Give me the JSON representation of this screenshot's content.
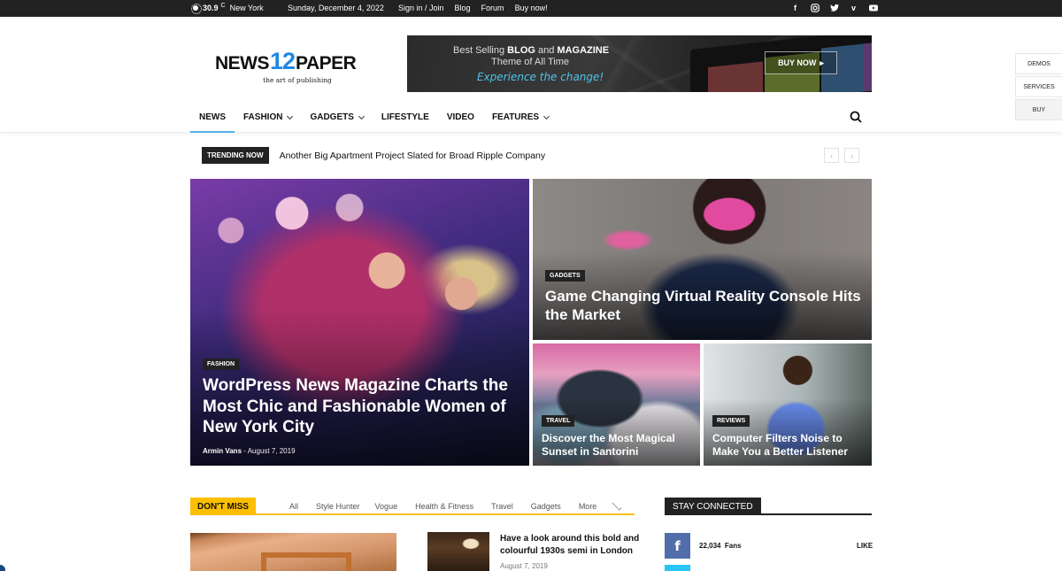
{
  "topbar": {
    "weather_icon": "sun-icon",
    "temperature": "30.9",
    "unit": "C",
    "city": "New York",
    "date": "Sunday, December 4, 2022",
    "links": [
      "Sign in / Join",
      "Blog",
      "Forum",
      "Buy now!"
    ],
    "social": [
      "facebook-icon",
      "instagram-icon",
      "twitter-icon",
      "vimeo-icon",
      "youtube-icon"
    ]
  },
  "header": {
    "logo": {
      "left": "NEWS",
      "number": "12",
      "right": "PAPER",
      "tagline": "the art of publishing"
    },
    "banner": {
      "line1_prefix": "Best Selling ",
      "line1_bold1": "BLOG",
      "line1_mid": " and ",
      "line1_bold2": "MAGAZINE",
      "line2": "Theme of All Time",
      "line3": "Experience the change!",
      "button": "BUY NOW",
      "button_icon": "caret-right-icon"
    },
    "side_tabs": [
      "DEMOS",
      "SERVICES",
      "BUY"
    ]
  },
  "nav": {
    "items": [
      {
        "label": "NEWS",
        "active": true,
        "dropdown": false
      },
      {
        "label": "FASHION",
        "active": false,
        "dropdown": true
      },
      {
        "label": "GADGETS",
        "active": false,
        "dropdown": true
      },
      {
        "label": "LIFESTYLE",
        "active": false,
        "dropdown": false
      },
      {
        "label": "VIDEO",
        "active": false,
        "dropdown": false
      },
      {
        "label": "FEATURES",
        "active": false,
        "dropdown": true
      }
    ],
    "search_icon": "search-icon",
    "accent": "#4db2ec"
  },
  "trending": {
    "label": "TRENDING NOW",
    "headline": "Another Big Apartment Project Slated for Broad Ripple Company",
    "prev": "‹",
    "next": "›"
  },
  "featured": [
    {
      "category": "FASHION",
      "title": "WordPress News Magazine Charts the Most Chic and Fashionable Women of New York City",
      "author": "Armin Vans",
      "separator": "-",
      "date": "August 7, 2019"
    },
    {
      "category": "GADGETS",
      "title": "Game Changing Virtual Reality Console Hits the Market"
    },
    {
      "category": "TRAVEL",
      "title": "Discover the Most Magical Sunset in Santorini"
    },
    {
      "category": "REVIEWS",
      "title": "Computer Filters Noise to Make You a Better Listener"
    }
  ],
  "dont_miss": {
    "label": "DON'T MISS",
    "accent": "#fcbf00",
    "tabs": [
      "All",
      "Style Hunter",
      "Vogue",
      "Health & Fitness",
      "Travel",
      "Gadgets",
      "More"
    ],
    "side_article": {
      "title": "Have a look around this bold and colourful 1930s semi in London",
      "date": "August 7, 2019"
    }
  },
  "stay_connected": {
    "label": "STAY CONNECTED",
    "facebook": {
      "icon": "f",
      "count": "22,034",
      "unit": "Fans",
      "action": "LIKE",
      "color": "#516eab"
    },
    "twitter_color": "#29c5f6"
  }
}
